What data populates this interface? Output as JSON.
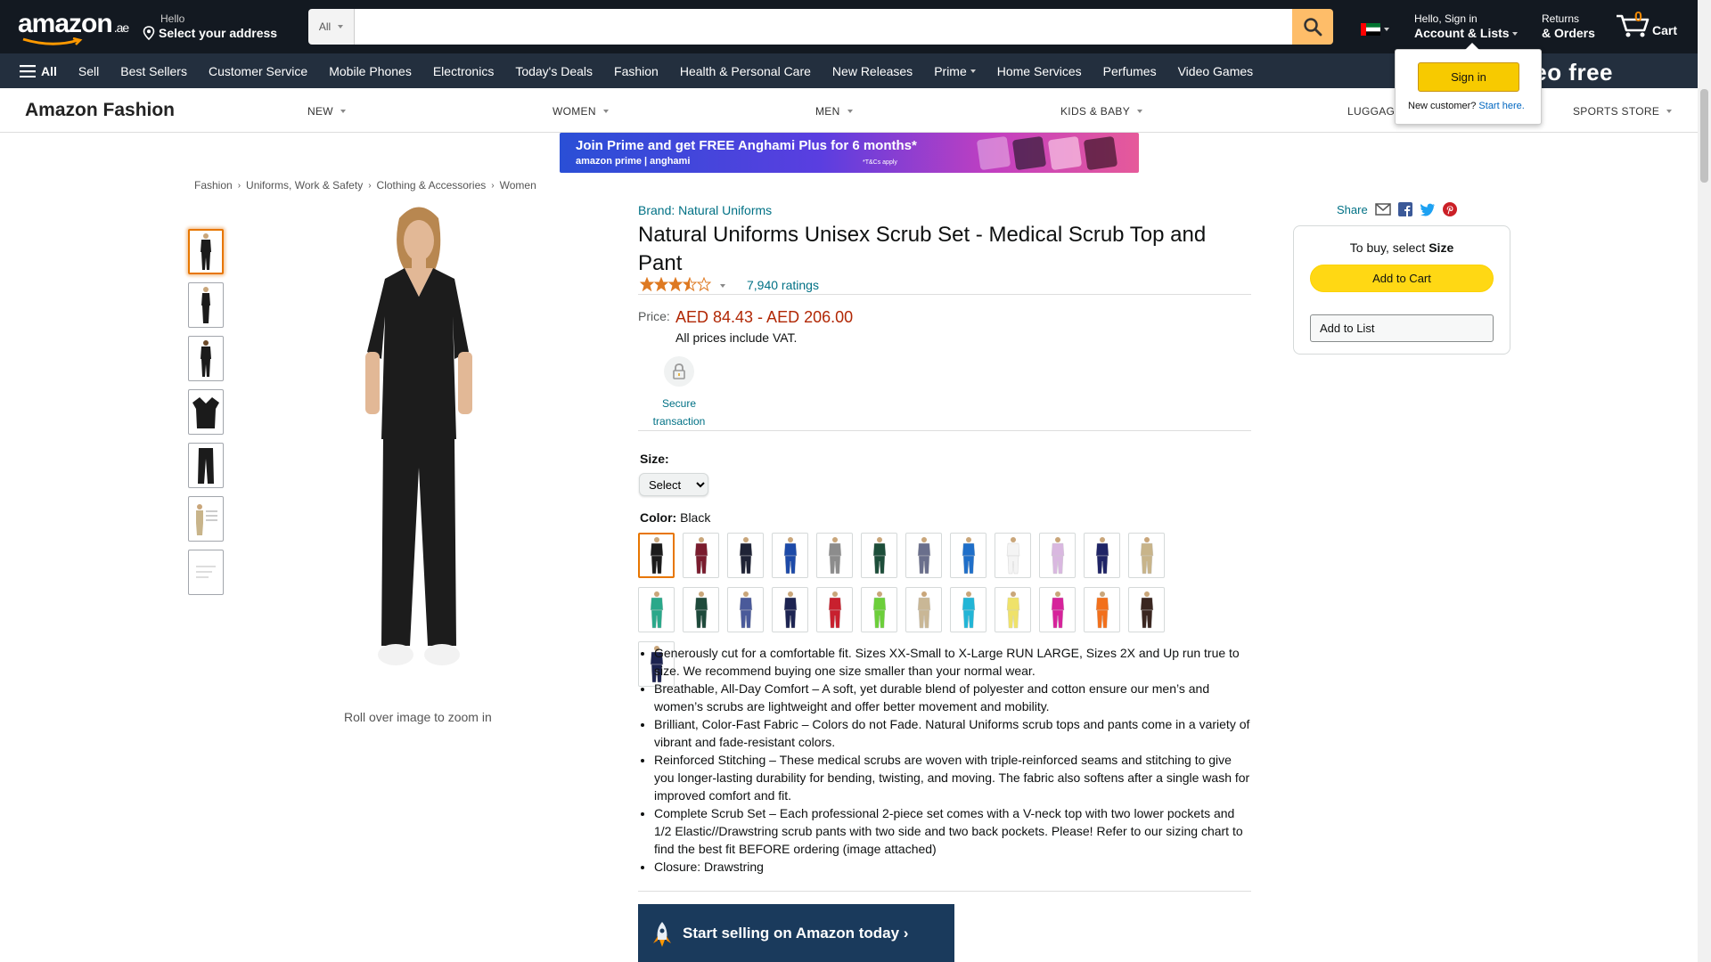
{
  "header": {
    "logo_text": "amazon",
    "logo_tld": ".ae",
    "deliver_line1": "Hello",
    "deliver_line2": "Select your address",
    "search_dept": "All",
    "search_placeholder": "",
    "account_line1": "Hello, Sign in",
    "account_line2": "Account & Lists",
    "returns_line1": "Returns",
    "returns_line2": "& Orders",
    "cart_count": "0",
    "cart_label": "Cart"
  },
  "nav": {
    "all_label": "All",
    "links": [
      "Sell",
      "Best Sellers",
      "Customer Service",
      "Mobile Phones",
      "Electronics",
      "Today's Deals",
      "Fashion",
      "Health & Personal Care",
      "New Releases",
      "Prime",
      "Home Services",
      "Perfumes",
      "Video Games"
    ],
    "promo_text": "me Video free"
  },
  "subnav": {
    "store_title": "Amazon Fashion",
    "items": [
      "NEW",
      "WOMEN",
      "MEN",
      "KIDS & BABY",
      "LUGGAGE",
      "SPORTS STORE"
    ]
  },
  "signin_flyout": {
    "button": "Sign in",
    "new_customer": "New customer?",
    "start_here": "Start here."
  },
  "banner": {
    "headline": "Join Prime and get FREE Anghami Plus for 6 months*",
    "brands": "amazon prime  |  anghami",
    "tc": "*T&Cs apply"
  },
  "breadcrumb": [
    "Fashion",
    "Uniforms, Work & Safety",
    "Clothing & Accessories",
    "Women"
  ],
  "gallery": {
    "zoom_hint": "Roll over image to zoom in",
    "thumbnail_count": 7
  },
  "product": {
    "brand_link": "Brand: Natural Uniforms",
    "title": "Natural Uniforms Unisex Scrub Set - Medical Scrub Top and Pant",
    "rating_value": 3.5,
    "ratings_count": "7,940 ratings",
    "price_label": "Price:",
    "price": "AED 84.43 - AED 206.00",
    "vat_note": "All prices include VAT.",
    "secure_label": "Secure transaction",
    "size_label": "Size:",
    "size_selected": "Select",
    "color_label": "Color:",
    "color_selected": "Black",
    "swatch_colors": [
      "#1b1b1b",
      "#7a1c2e",
      "#1f2336",
      "#1d4aa8",
      "#8c8c8c",
      "#1d4e3a",
      "#6a6f8c",
      "#1f6fc9",
      "#f4f4f4",
      "#d9b8e0",
      "#1f2466",
      "#c8b48a",
      "#2aa88a",
      "#1e4a3b",
      "#4a5a9a",
      "#1d2452",
      "#c8202e",
      "#6ccf3a",
      "#c9b796",
      "#22b5d6",
      "#efe26a",
      "#d6239b",
      "#f2701c",
      "#3a2620",
      "#1c2350"
    ],
    "bullets": [
      "Generously cut for a comfortable fit. Sizes XX-Small to X-Large RUN LARGE, Sizes 2X and Up run true to size. We recommend buying one size smaller than your normal wear.",
      "Breathable, All-Day Comfort – A soft, yet durable blend of polyester and cotton ensure our men’s and women’s scrubs are lightweight and offer better movement and mobility.",
      "Brilliant, Color-Fast Fabric – Colors do not Fade. Natural Uniforms scrub tops and pants come in a variety of vibrant and fade-resistant colors.",
      "Reinforced Stitching – These medical scrubs are woven with triple-reinforced seams and stitching to give you longer-lasting durability for bending, twisting, and moving. The fabric also softens after a single wash for improved comfort and fit.",
      "Complete Scrub Set – Each professional 2-piece set comes with a V-neck top with two lower pockets and 1/2 Elastic//Drawstring scrub pants with two side and two back pockets. Please! Refer to our sizing chart to find the best fit BEFORE ordering (image attached)",
      "Closure: Drawstring"
    ],
    "sell_banner": "Start selling on Amazon today ›"
  },
  "buybox": {
    "share_label": "Share",
    "prompt_prefix": "To buy, select ",
    "prompt_bold": "Size",
    "add_to_cart": "Add to Cart",
    "add_to_list": "Add to List"
  }
}
